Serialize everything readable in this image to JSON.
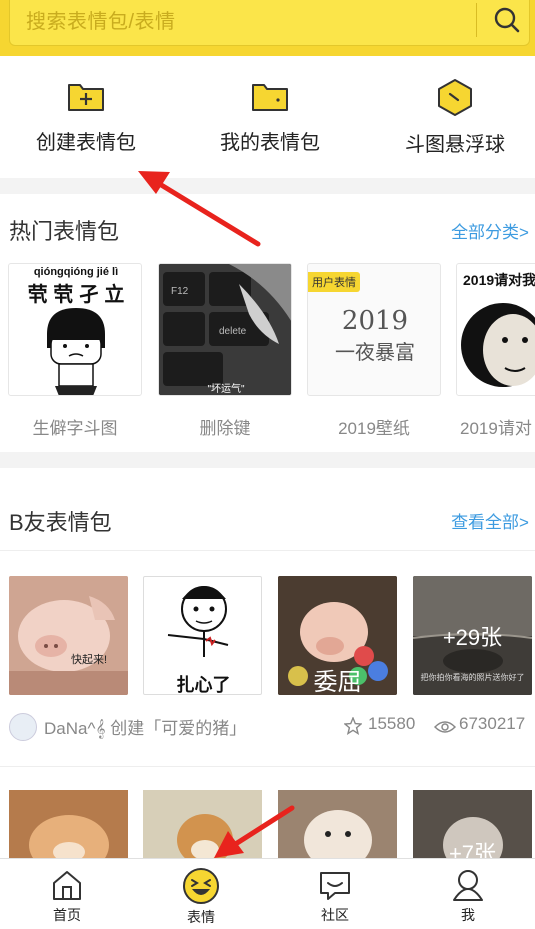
{
  "search": {
    "placeholder": "搜索表情包/表情"
  },
  "quick_actions": [
    {
      "label": "创建表情包"
    },
    {
      "label": "我的表情包"
    },
    {
      "label": "斗图悬浮球"
    }
  ],
  "hot": {
    "title": "热门表情包",
    "more": "全部分类>",
    "packs": [
      {
        "label": "生僻字斗图",
        "image_text": [
          "qióngqióng jié  lì",
          "茕 茕 孑 立"
        ]
      },
      {
        "label": "删除键",
        "image_text": [
          "F12",
          "delete",
          "\"坏运气\""
        ]
      },
      {
        "label": "2019壁纸",
        "image_text": [
          "用户表情",
          "2019",
          "一夜暴富"
        ]
      },
      {
        "label": "2019请对",
        "image_text": [
          "2019请对我"
        ]
      }
    ]
  },
  "bfriend": {
    "title": "B友表情包",
    "more": "查看全部>",
    "thumbs": [
      {
        "caption": "快起来!"
      },
      {
        "caption": "扎心了"
      },
      {
        "caption": "委屈"
      },
      {
        "caption": "+29张",
        "subcaption": "把你拍你看海的照片送你好了"
      }
    ],
    "author": "DaNa^𝄞 创建「可爱的猪」",
    "stars": "15580",
    "views": "6730217",
    "row2_more": "+7张"
  },
  "nav": [
    {
      "label": "首页",
      "icon": "home-icon"
    },
    {
      "label": "表情",
      "icon": "laugh-face-icon"
    },
    {
      "label": "社区",
      "icon": "chat-icon"
    },
    {
      "label": "我",
      "icon": "profile-icon"
    }
  ],
  "colors": {
    "header": "#f6d631",
    "link": "#3d9be0",
    "arrow": "#e8231d"
  }
}
